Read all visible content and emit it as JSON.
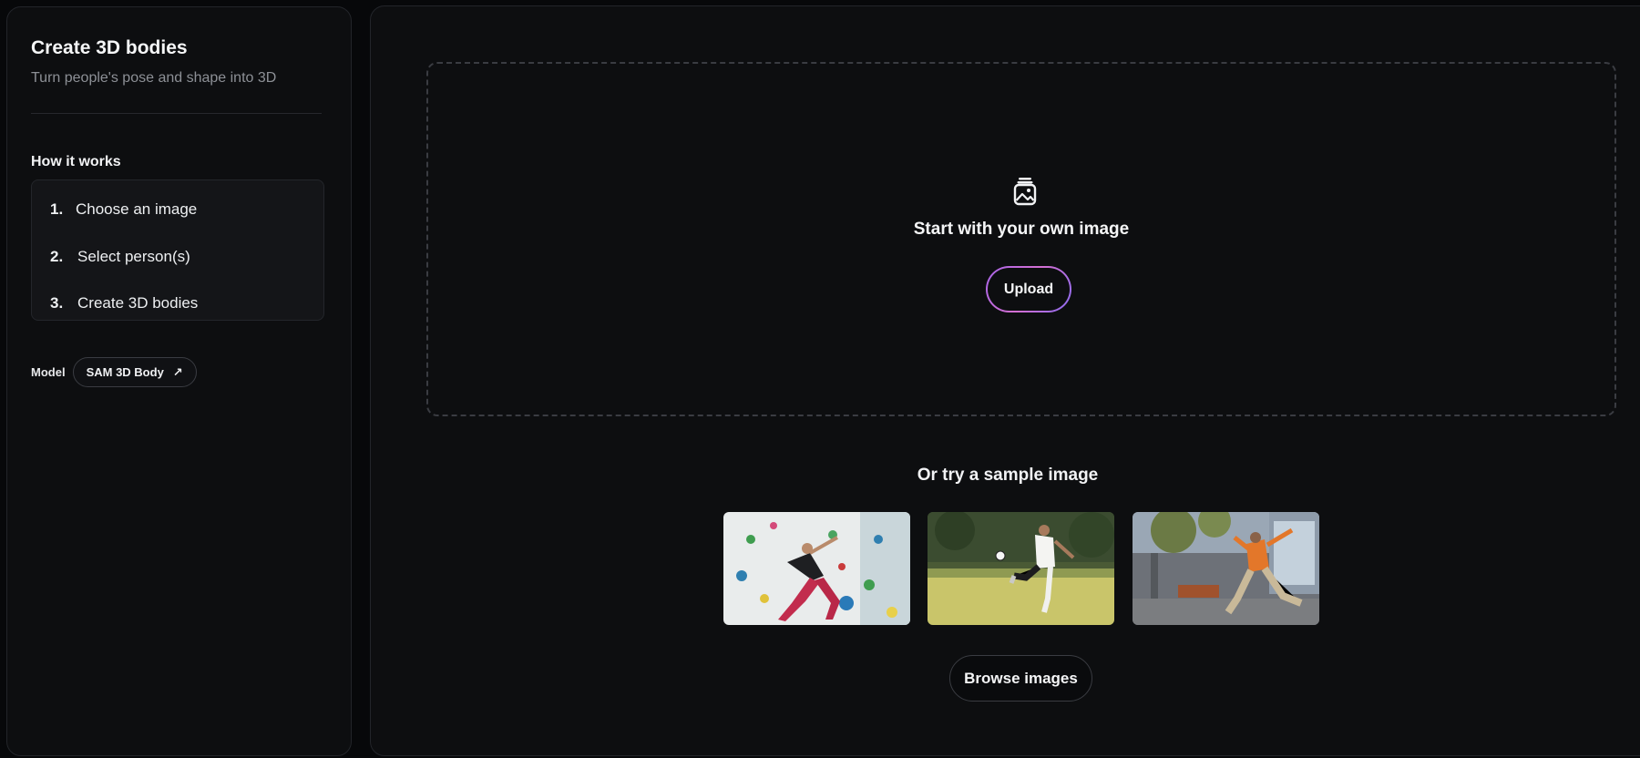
{
  "sidebar": {
    "title": "Create 3D bodies",
    "subtitle": "Turn people's pose and shape into 3D",
    "how_title": "How it works",
    "steps": [
      {
        "num": "1.",
        "label": "Choose an image"
      },
      {
        "num": "2.",
        "label": "Select person(s)"
      },
      {
        "num": "3.",
        "label": "Create 3D bodies"
      }
    ],
    "model_label": "Model",
    "model_name": "SAM 3D Body",
    "model_icon": "arrow-up-right-icon"
  },
  "main": {
    "drop_icon": "image-jar-icon",
    "drop_title": "Start with your own image",
    "upload_label": "Upload",
    "sample_title": "Or try a sample image",
    "samples": [
      "climbing-wall-photo",
      "soccer-kick-photo",
      "street-dance-photo"
    ],
    "browse_label": "Browse images"
  },
  "colors": {
    "background": "#07080a",
    "panel": "#0d0e10",
    "upload_gradient_start": "#a865e8",
    "upload_gradient_end": "#8c6cf0"
  }
}
